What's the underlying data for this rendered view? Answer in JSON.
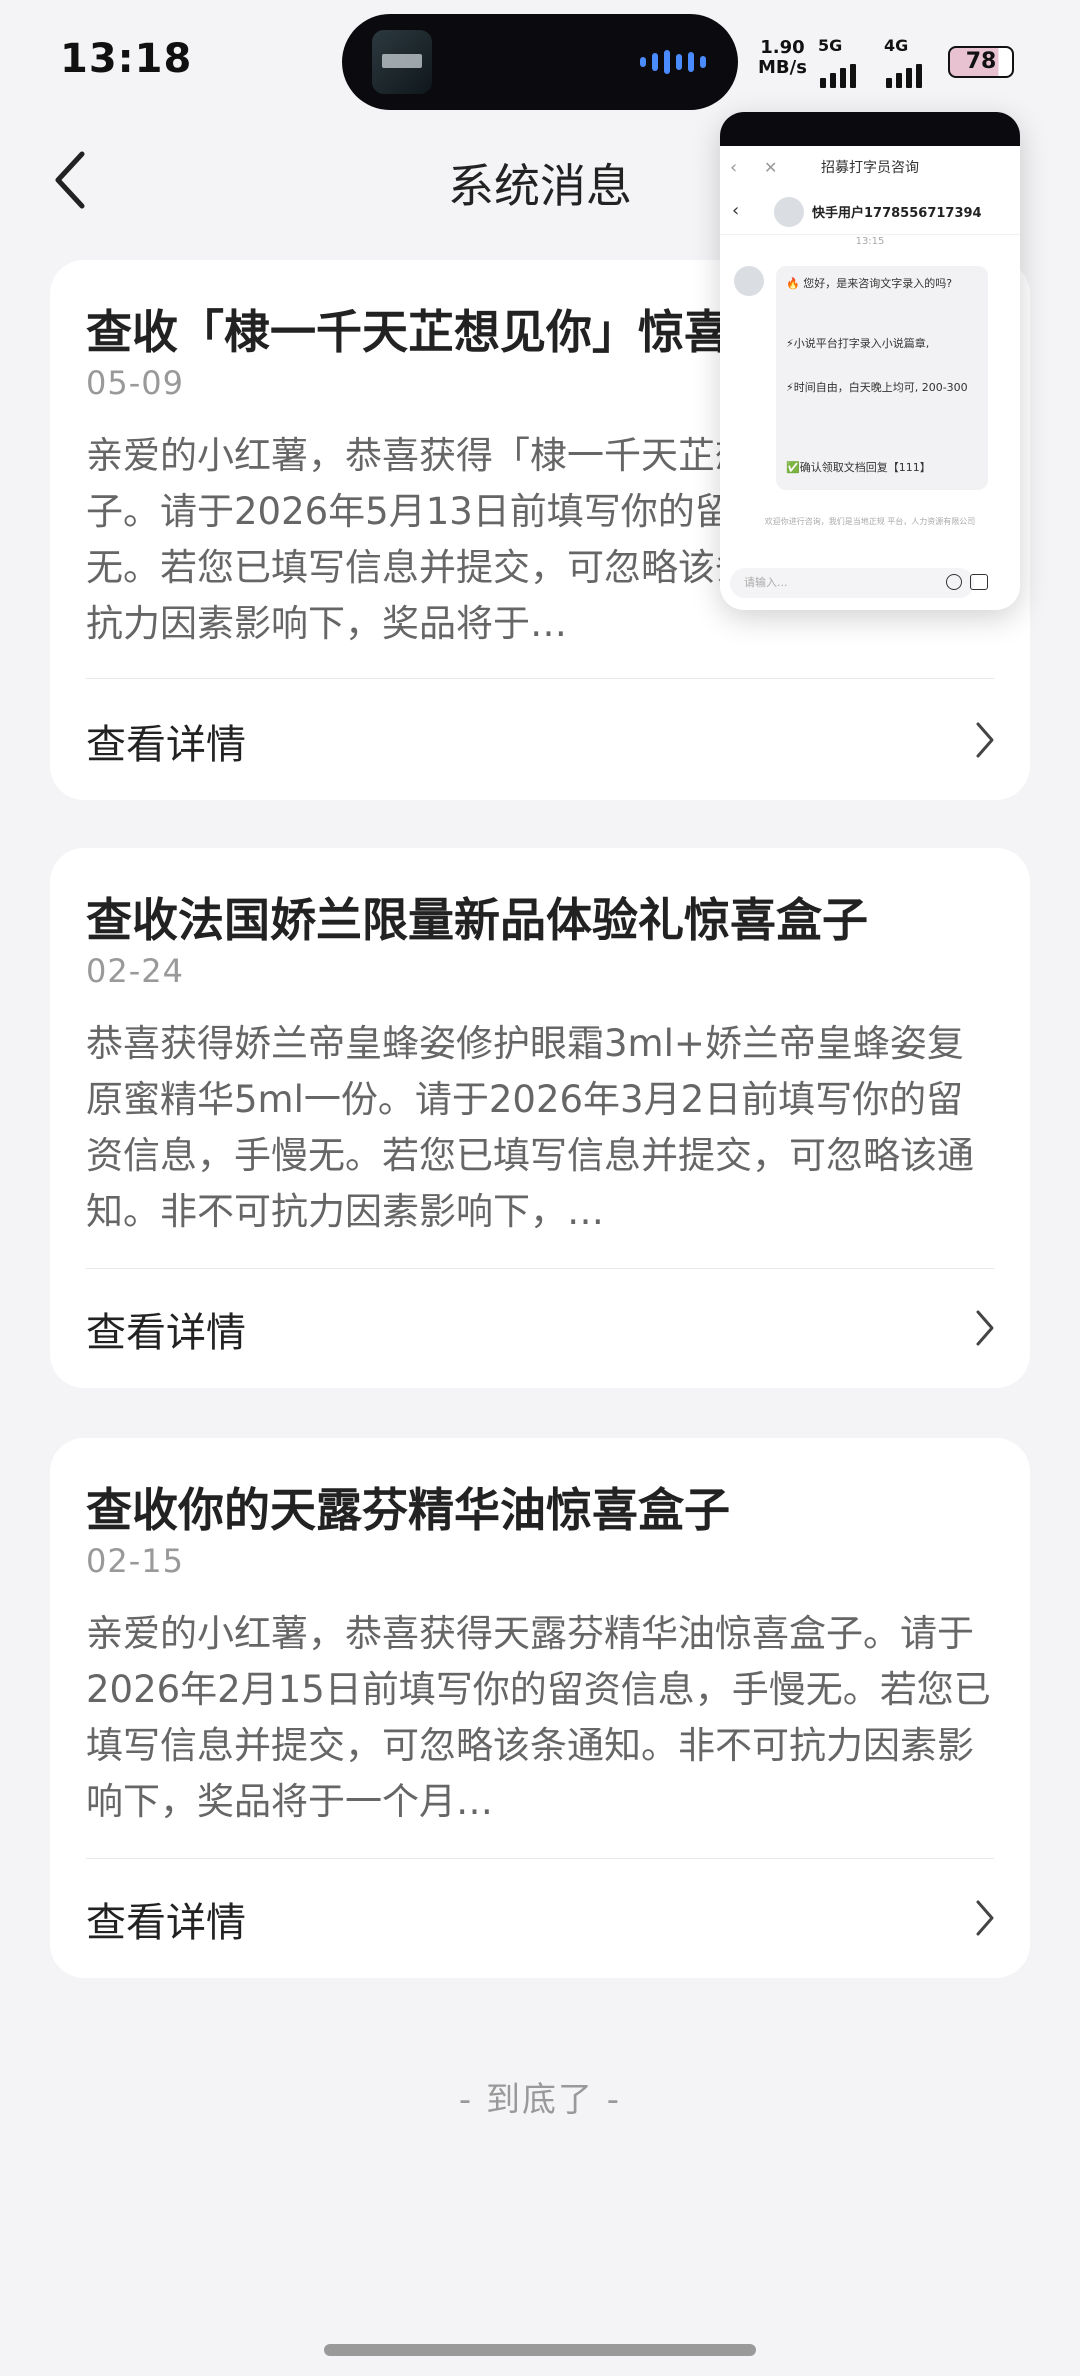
{
  "status_bar": {
    "time": "13:18",
    "net_speed_value": "1.90",
    "net_speed_unit": "MB/s",
    "network_5g": "5G",
    "network_4g": "4G",
    "battery": "78"
  },
  "header": {
    "title": "系统消息"
  },
  "messages": [
    {
      "title": "查收「棣一千天芷想见你」惊喜盒子",
      "date": "05-09",
      "body": "亲爱的小红薯，恭喜获得「棣一千天芷想见你」惊喜盒子。请于2026年5月13日前填写你的留资信息，手慢无。若您已填写信息并提交，可忽略该条通知。非不可抗力因素影响下，奖品将于…",
      "detail_label": "查看详情"
    },
    {
      "title": "查收法国娇兰限量新品体验礼惊喜盒子",
      "date": "02-24",
      "body": "恭喜获得娇兰帝皇蜂姿修护眼霜3ml+娇兰帝皇蜂姿复原蜜精华5ml一份。请于2026年3月2日前填写你的留资信息，手慢无。若您已填写信息并提交，可忽略该通知。非不可抗力因素影响下，…",
      "detail_label": "查看详情"
    },
    {
      "title": "查收你的天露芬精华油惊喜盒子",
      "date": "02-15",
      "body": "亲爱的小红薯，恭喜获得天露芬精华油惊喜盒子。请于2026年2月15日前填写你的留资信息，手慢无。若您已填写信息并提交，可忽略该条通知。非不可抗力因素影响下，奖品将于一个月…",
      "detail_label": "查看详情"
    }
  ],
  "footer": {
    "end_label": "- 到底了 -"
  },
  "floating_window": {
    "title": "招募打字员咨询",
    "contact_name": "快手用户1778556717394",
    "time": "13:15",
    "lines": [
      "🔥 您好，是来咨询文字录入的吗?",
      "⚡小说平台打字录入小说篇章,",
      "⚡时间自由，白天晚上均可, 200-300",
      "✅确认领取文档回复【111】"
    ],
    "notice": "欢迎你进行咨询，我们是当地正规 平台，人力资源有限公司",
    "input_placeholder": "请输入..."
  }
}
